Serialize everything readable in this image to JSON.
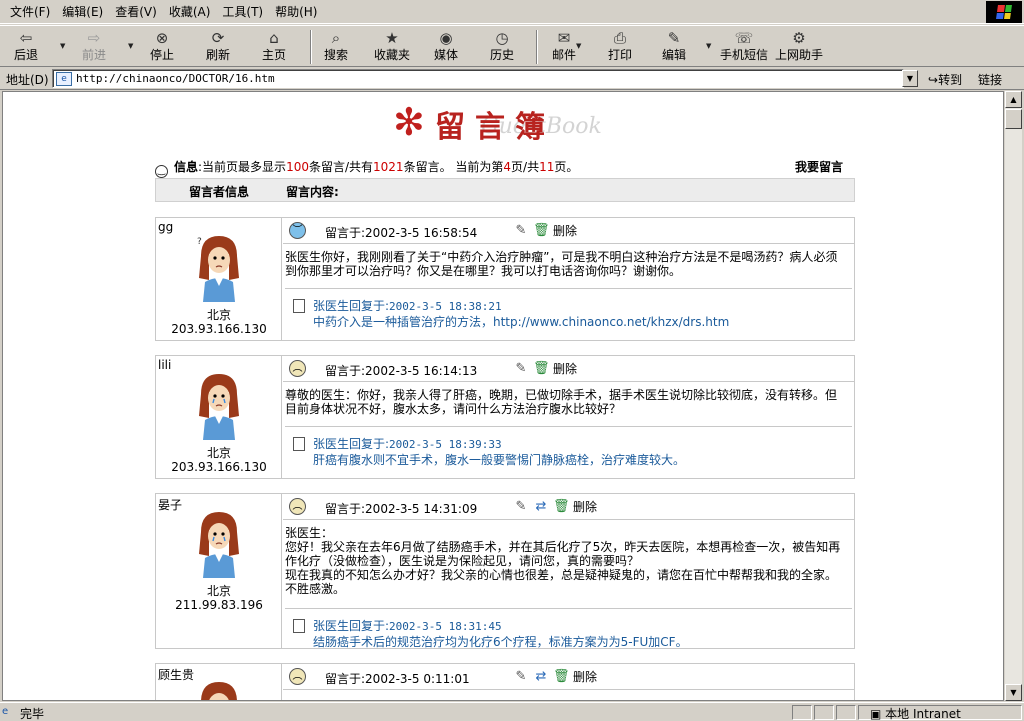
{
  "menu": [
    "文件(F)",
    "编辑(E)",
    "查看(V)",
    "收藏(A)",
    "工具(T)",
    "帮助(H)"
  ],
  "toolbar": {
    "back": "后退",
    "forward": "前进",
    "stop": "停止",
    "refresh": "刷新",
    "home": "主页",
    "search": "搜索",
    "favorites": "收藏夹",
    "media": "媒体",
    "history": "历史",
    "mail": "邮件",
    "print": "打印",
    "edit": "编辑",
    "sms": "手机短信",
    "helper": "上网助手"
  },
  "address": {
    "label": "地址(D)",
    "url": "http://chinaonco/DOCTOR/16.htm",
    "goto": "转到",
    "links": "链接"
  },
  "page": {
    "banner_cn": "留言簿",
    "banner_en": "GuestBook",
    "info_prefix": "信息",
    "info_a": ":当前页最多显示",
    "info_max": "100",
    "info_b": "条留言/共有",
    "info_total": "1021",
    "info_c": "条留言。 当前为第",
    "info_cur": "4",
    "info_d": "页/共",
    "info_pages": "11",
    "info_e": "页。",
    "leave_msg": "我要留言",
    "col_user": "留言者信息",
    "col_content": "留言内容:",
    "delete_label": "删除"
  },
  "entries": [
    {
      "name": "gg",
      "location": "北京",
      "ip": "203.93.166.130",
      "time": "留言于:2002-3-5 16:58:54",
      "message": "张医生你好，我刚刚看了关于“中药介入治疗肿瘤”，可是我不明白这种治疗方法是不是喝汤药？病人必须到你那里才可以治疗吗？你又是在哪里？我可以打电话咨询你吗？谢谢你。",
      "reply_head": "张医生回复于:",
      "reply_time": "2002-3-5 18:38:21",
      "reply_text": "中药介入是一种插管治疗的方法，http://www.chinaonco.net/khzx/drs.htm"
    },
    {
      "name": "lili",
      "location": "北京",
      "ip": "203.93.166.130",
      "time": "留言于:2002-3-5 16:14:13",
      "message": "尊敬的医生：你好，我亲人得了肝癌，晚期，已做切除手术，据手术医生说切除比较彻底，没有转移。但目前身体状况不好，腹水太多，请问什么方法治疗腹水比较好？",
      "reply_head": "张医生回复于:",
      "reply_time": "2002-3-5 18:39:33",
      "reply_text": "肝癌有腹水则不宜手术，腹水一般要警惕门静脉癌栓，治疗难度较大。"
    },
    {
      "name": "晏子",
      "location": "北京",
      "ip": "211.99.83.196",
      "time": "留言于:2002-3-5 14:31:09",
      "message_lines": [
        "张医生：",
        "您好！我父亲在去年6月做了结肠癌手术，并在其后化疗了5次，昨天去医院，本想再检查一次，被告知再作化疗（没做检查），医生说是为保险起见，请问您，真的需要吗？",
        "现在我真的不知怎么办才好？我父亲的心情也很差，总是疑神疑鬼的，请您在百忙中帮帮我和我的全家。",
        "不胜感激。"
      ],
      "reply_head": "张医生回复于:",
      "reply_time": "2002-3-5 18:31:45",
      "reply_text": "结肠癌手术后的规范治疗均为化疗6个疗程，标准方案为为5-FU加CF。"
    },
    {
      "name": "顾生贵",
      "time": "留言于:2002-3-5 0:11:01"
    }
  ],
  "status": {
    "text": "完毕",
    "zone": "本地 Intranet"
  },
  "colors": {
    "accent_red": "#c00000",
    "reply_blue": "#1a5a9a",
    "chrome": "#d4d0c8"
  }
}
